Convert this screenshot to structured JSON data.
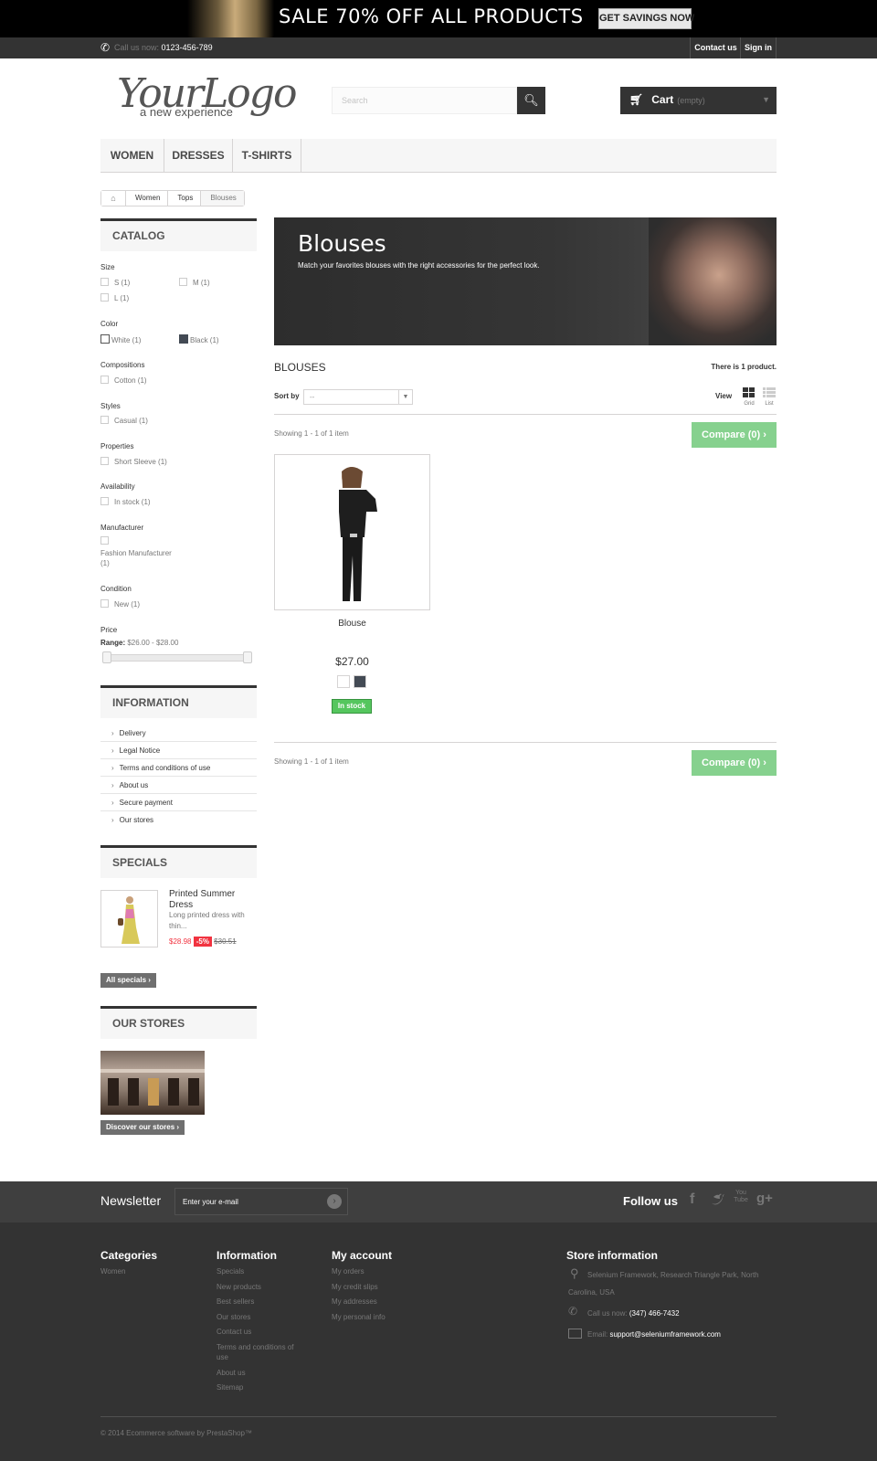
{
  "banner": {
    "headline": "SALE 70% OFF ALL PRODUCTS",
    "button": "GET SAVINGS NOW"
  },
  "topbar": {
    "call_label": "Call us now:",
    "phone": "0123-456-789",
    "contact": "Contact us",
    "signin": "Sign in"
  },
  "logo": {
    "main": "YourLogo",
    "tagline": "a new experience"
  },
  "search": {
    "placeholder": "Search"
  },
  "cart": {
    "label": "Cart",
    "status": "(empty)"
  },
  "menu": [
    "WOMEN",
    "DRESSES",
    "T-SHIRTS"
  ],
  "breadcrumb": [
    "Women",
    "Tops",
    "Blouses"
  ],
  "catalog": {
    "title": "CATALOG",
    "size": {
      "title": "Size",
      "options": [
        "S (1)",
        "M (1)",
        "L (1)"
      ]
    },
    "color": {
      "title": "Color",
      "options": [
        "White (1)",
        "Black (1)"
      ],
      "swatches": [
        "#ffffff",
        "#434a54"
      ]
    },
    "compositions": {
      "title": "Compositions",
      "options": [
        "Cotton (1)"
      ]
    },
    "styles": {
      "title": "Styles",
      "options": [
        "Casual (1)"
      ]
    },
    "properties": {
      "title": "Properties",
      "options": [
        "Short Sleeve (1)"
      ]
    },
    "availability": {
      "title": "Availability",
      "options": [
        "In stock (1)"
      ]
    },
    "manufacturer": {
      "title": "Manufacturer",
      "options": [
        "Fashion Manufacturer",
        "(1)"
      ]
    },
    "condition": {
      "title": "Condition",
      "options": [
        "New (1)"
      ]
    },
    "price": {
      "title": "Price",
      "range_label": "Range:",
      "range": "$26.00 - $28.00"
    }
  },
  "information": {
    "title": "INFORMATION",
    "links": [
      "Delivery",
      "Legal Notice",
      "Terms and conditions of use",
      "About us",
      "Secure payment",
      "Our stores"
    ]
  },
  "specials": {
    "title": "SPECIALS",
    "product": {
      "name_line1": "Printed Summer",
      "name_line2": "Dress",
      "desc_line1": "Long printed dress with",
      "desc_line2": "thin...",
      "price": "$28.98",
      "discount": "-5%",
      "old_price": "$30.51"
    },
    "button": "All specials"
  },
  "stores": {
    "title": "OUR STORES",
    "button": "Discover our stores"
  },
  "category": {
    "title": "Blouses",
    "description": "Match your favorites blouses with the right accessories for the perfect look.",
    "heading": "BLOUSES",
    "count_prefix": "There is ",
    "count": "1",
    "count_suffix": " product.",
    "sort_label": "Sort by",
    "sort_value": "--",
    "view_label": "View",
    "grid_label": "Grid",
    "list_label": "List",
    "showing": "Showing 1 - 1 of 1 item",
    "compare": "Compare (0)"
  },
  "product": {
    "name": "Blouse",
    "price": "$27.00",
    "colors": [
      "#ffffff",
      "#434a54"
    ],
    "availability": "In stock",
    "availability_color": "#55c65e"
  },
  "newsletter": {
    "title": "Newsletter",
    "placeholder": "Enter your e-mail",
    "follow": "Follow us"
  },
  "footer": {
    "categories": {
      "title": "Categories",
      "links": [
        "Women"
      ]
    },
    "information": {
      "title": "Information",
      "links": [
        "Specials",
        "New products",
        "Best sellers",
        "Our stores",
        "Contact us",
        "Terms and conditions of",
        "use",
        "About us",
        "Sitemap"
      ]
    },
    "account": {
      "title": "My account",
      "links": [
        "My orders",
        "My credit slips",
        "My addresses",
        "My personal info"
      ]
    },
    "store": {
      "title": "Store information",
      "address_line1": "Selenium Framework, Research Triangle Park, North",
      "address_line2": "Carolina, USA",
      "call_label": "Call us now:",
      "phone": "(347) 466-7432",
      "email_label": "Email:",
      "email": "support@seleniumframework.com"
    },
    "copyright": "© 2014 Ecommerce software by PrestaShop™"
  }
}
